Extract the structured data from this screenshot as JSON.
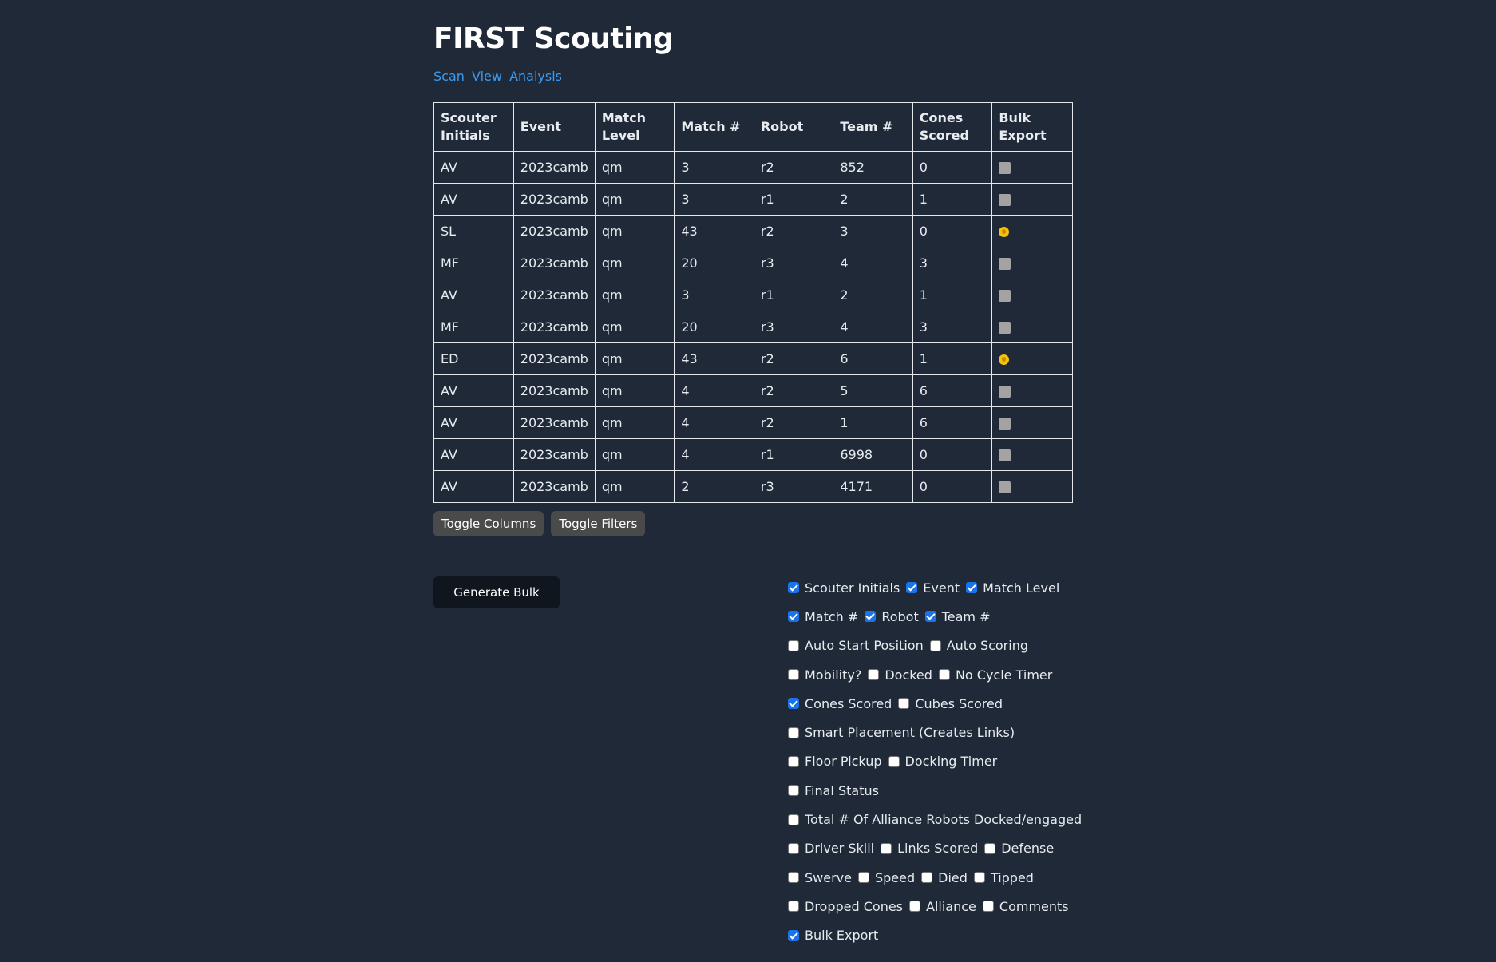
{
  "page": {
    "title": "FIRST Scouting",
    "nav_links": [
      "Scan",
      "View",
      "Analysis"
    ]
  },
  "table": {
    "headers": [
      "Scouter Initials",
      "Event",
      "Match Level",
      "Match #",
      "Robot",
      "Team #",
      "Cones Scored",
      "Bulk Export"
    ],
    "rows": [
      {
        "initials": "AV",
        "event": "2023camb",
        "level": "qm",
        "match": "3",
        "robot": "r2",
        "team": "852",
        "cones": "0",
        "bulk": "unchecked"
      },
      {
        "initials": "AV",
        "event": "2023camb",
        "level": "qm",
        "match": "3",
        "robot": "r1",
        "team": "2",
        "cones": "1",
        "bulk": "unchecked"
      },
      {
        "initials": "SL",
        "event": "2023camb",
        "level": "qm",
        "match": "43",
        "robot": "r2",
        "team": "3",
        "cones": "0",
        "bulk": "emoji"
      },
      {
        "initials": "MF",
        "event": "2023camb",
        "level": "qm",
        "match": "20",
        "robot": "r3",
        "team": "4",
        "cones": "3",
        "bulk": "unchecked"
      },
      {
        "initials": "AV",
        "event": "2023camb",
        "level": "qm",
        "match": "3",
        "robot": "r1",
        "team": "2",
        "cones": "1",
        "bulk": "unchecked"
      },
      {
        "initials": "MF",
        "event": "2023camb",
        "level": "qm",
        "match": "20",
        "robot": "r3",
        "team": "4",
        "cones": "3",
        "bulk": "unchecked"
      },
      {
        "initials": "ED",
        "event": "2023camb",
        "level": "qm",
        "match": "43",
        "robot": "r2",
        "team": "6",
        "cones": "1",
        "bulk": "emoji"
      },
      {
        "initials": "AV",
        "event": "2023camb",
        "level": "qm",
        "match": "4",
        "robot": "r2",
        "team": "5",
        "cones": "6",
        "bulk": "unchecked"
      },
      {
        "initials": "AV",
        "event": "2023camb",
        "level": "qm",
        "match": "4",
        "robot": "r2",
        "team": "1",
        "cones": "6",
        "bulk": "unchecked"
      },
      {
        "initials": "AV",
        "event": "2023camb",
        "level": "qm",
        "match": "4",
        "robot": "r1",
        "team": "6998",
        "cones": "0",
        "bulk": "unchecked"
      },
      {
        "initials": "AV",
        "event": "2023camb",
        "level": "qm",
        "match": "2",
        "robot": "r3",
        "team": "4171",
        "cones": "0",
        "bulk": "unchecked"
      }
    ]
  },
  "buttons": {
    "toggle_columns": "Toggle Columns",
    "toggle_filters": "Toggle Filters",
    "generate_bulk": "Generate Bulk"
  },
  "column_toggles": [
    [
      {
        "label": "Scouter Initials",
        "checked": true
      },
      {
        "label": "Event",
        "checked": true
      },
      {
        "label": "Match Level",
        "checked": true
      }
    ],
    [
      {
        "label": "Match #",
        "checked": true
      },
      {
        "label": "Robot",
        "checked": true
      },
      {
        "label": "Team #",
        "checked": true
      }
    ],
    [
      {
        "label": "Auto Start Position",
        "checked": false
      },
      {
        "label": "Auto Scoring",
        "checked": false
      }
    ],
    [
      {
        "label": "Mobility?",
        "checked": false
      },
      {
        "label": "Docked",
        "checked": false
      },
      {
        "label": "No Cycle Timer",
        "checked": false
      }
    ],
    [
      {
        "label": "Cones Scored",
        "checked": true
      },
      {
        "label": "Cubes Scored",
        "checked": false
      }
    ],
    [
      {
        "label": "Smart Placement (Creates Links)",
        "checked": false
      }
    ],
    [
      {
        "label": "Floor Pickup",
        "checked": false
      },
      {
        "label": "Docking Timer",
        "checked": false
      }
    ],
    [
      {
        "label": "Final Status",
        "checked": false
      }
    ],
    [
      {
        "label": "Total # Of Alliance Robots Docked/engaged",
        "checked": false
      }
    ],
    [
      {
        "label": "Driver Skill",
        "checked": false
      },
      {
        "label": "Links Scored",
        "checked": false
      },
      {
        "label": "Defense",
        "checked": false
      }
    ],
    [
      {
        "label": "Swerve",
        "checked": false
      },
      {
        "label": "Speed",
        "checked": false
      },
      {
        "label": "Died",
        "checked": false
      },
      {
        "label": "Tipped",
        "checked": false
      }
    ],
    [
      {
        "label": "Dropped Cones",
        "checked": false
      },
      {
        "label": "Alliance",
        "checked": false
      },
      {
        "label": "Comments",
        "checked": false
      }
    ],
    [
      {
        "label": "Bulk Export",
        "checked": true
      }
    ]
  ],
  "colors": {
    "background": "#1f2937",
    "link": "#3b9bf0",
    "checkbox_on": "#1a73e8"
  }
}
